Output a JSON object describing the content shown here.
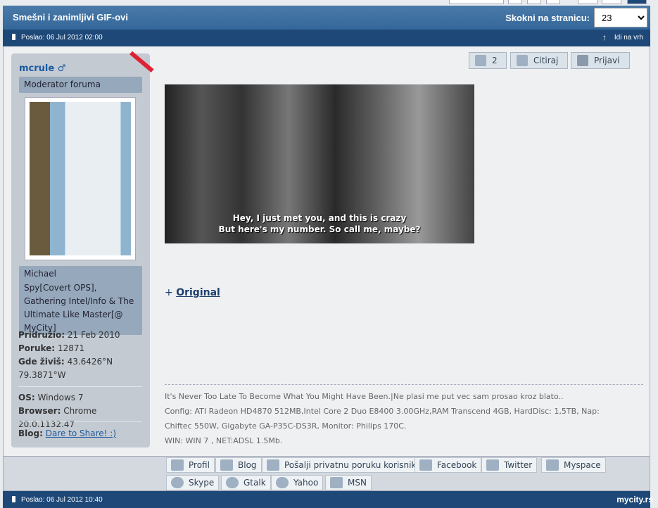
{
  "header": {
    "title": "Smešni i zanimljivi GIF-ovi",
    "jump_label": "Skokni na stranicu:",
    "jump_value": "23"
  },
  "post": {
    "posted": "Poslao: 06 Jul 2012 02:00",
    "go_top": "Idi na vrh",
    "user": {
      "name": "mcrule",
      "gender": "♂",
      "rank": "Moderator foruma",
      "real_name": "Michael",
      "title": "Spy[Covert OPS], Gathering Intel/Info & The Ultimate Like Master[@ MyCity]",
      "joined_label": "Pridružio:",
      "joined": "21 Feb 2010",
      "posts_label": "Poruke:",
      "posts": "12871",
      "loc_label": "Gde živiš:",
      "loc1": "43.6426°N",
      "loc2": "79.3871°W",
      "os_label": "OS:",
      "os": "Windows 7",
      "browser_label": "Browser:",
      "browser": "Chrome 20.0.1132.47",
      "blog_label": "Blog:",
      "blog": "Dare to Share! :)"
    },
    "actions": {
      "likes": "2",
      "quote": "Citiraj",
      "report": "Prijavi"
    },
    "gif_caption1": "Hey, I just met you, and this is crazy",
    "gif_caption2": "But here's my number. So call me, maybe?",
    "original_prefix": "+",
    "original": "Original",
    "signature": [
      "It's Never Too Late To Become What You Might Have Been.|Ne plasi me put vec sam prosao kroz blato..",
      "Config: ATI Radeon HD4870 512MB,Intel Core 2 Duo E8400 3.00GHz,RAM Transcend 4GB, HardDisc: 1,5TB, Nap:",
      "Chiftec 550W, Gigabyte GA-P35C-DS3R, Monitor: Philips 170C.",
      "WIN: WIN 7 , NET:ADSL 1.5Mb."
    ]
  },
  "footer_buttons": [
    "Profil",
    "Blog",
    "Pošalji privatnu poruku korisniku",
    "Facebook",
    "Twitter",
    "Myspace",
    "Skype",
    "Gtalk",
    "Yahoo",
    "MSN"
  ],
  "next_post": {
    "posted": "Poslao: 06 Jul 2012 10:40"
  },
  "watermark": "mycity.rs"
}
